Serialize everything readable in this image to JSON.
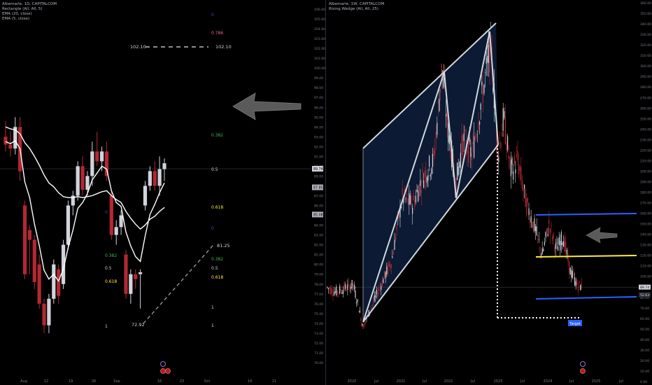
{
  "left_panel": {
    "legend": [
      "Albemarle, 1D, CAPITALCOM",
      "Rectangle (All, All, 5)",
      "EMA (20, close)",
      "EMA (5, close)"
    ],
    "price_axis": {
      "min": 69.0,
      "max": 106.0,
      "ticks": [
        70.0,
        71.0,
        72.0,
        73.0,
        74.0,
        75.0,
        76.0,
        77.0,
        78.0,
        79.0,
        80.0,
        81.0,
        82.0,
        83.0,
        84.0,
        85.0,
        86.0,
        87.0,
        88.0,
        89.0,
        90.0,
        91.0,
        92.0,
        93.0,
        94.0,
        95.0,
        96.0,
        97.0,
        98.0,
        99.0,
        100.0,
        101.0,
        102.0,
        103.0,
        104.0,
        105.0,
        106.0
      ]
    },
    "price_badges": [
      "89.74",
      "87.85",
      "85.08"
    ],
    "time_axis": [
      "Aug",
      "12",
      "19",
      "26",
      "Sep",
      "16",
      "23",
      "Oct",
      "14",
      "21"
    ],
    "levels": {
      "top_left": "102.10",
      "top_right": "102.10",
      "lower_right": "81.25",
      "bottom_left": "72.92"
    },
    "fib_right": [
      {
        "label": "0",
        "color": "#3f51b5"
      },
      {
        "label": "0.786",
        "color": "#f06292"
      },
      {
        "label": "0.382",
        "color": "#4caf50"
      },
      {
        "label": "0.5",
        "color": "#d1d4dc"
      },
      {
        "label": "0.618",
        "color": "#ffeb3b"
      },
      {
        "label": "0",
        "color": "#3f51b5"
      },
      {
        "label": "0.382",
        "color": "#4caf50"
      },
      {
        "label": "0.5",
        "color": "#d1d4dc"
      },
      {
        "label": "0.618",
        "color": "#ffeb3b"
      },
      {
        "label": "1",
        "color": "#d1d4dc"
      },
      {
        "label": "1",
        "color": "#d1d4dc"
      }
    ],
    "fib_mid": [
      {
        "label": "0",
        "color": "#3f51b5"
      },
      {
        "label": "0.382",
        "color": "#4caf50"
      },
      {
        "label": "0.5",
        "color": "#d1d4dc"
      },
      {
        "label": "0.618",
        "color": "#ffeb3b"
      },
      {
        "label": "1",
        "color": "#d1d4dc"
      }
    ]
  },
  "right_panel": {
    "legend": [
      "Albemarle, 1W, CAPITALCOM",
      "Rising Wedge (All, All, 25)"
    ],
    "price_axis": {
      "min": 0,
      "max": 360,
      "ticks": [
        0.0,
        10.0,
        20.0,
        30.0,
        40.0,
        50.0,
        60.0,
        70.0,
        80.0,
        90.0,
        100.0,
        110.0,
        120.0,
        130.0,
        140.0,
        150.0,
        160.0,
        170.0,
        180.0,
        190.0,
        200.0,
        210.0,
        220.0,
        230.0,
        240.0,
        250.0,
        260.0,
        270.0,
        280.0,
        290.0,
        300.0,
        310.0,
        320.0,
        330.0,
        340.0,
        350.0,
        360.0
      ]
    },
    "price_badges": [
      "89.74",
      "52.63"
    ],
    "time_axis": [
      "2020",
      "Jul",
      "2021",
      "Jul",
      "2022",
      "Jul",
      "2023",
      "Jul",
      "2024",
      "Jul",
      "2025",
      "Jul"
    ],
    "target_label": "Target"
  },
  "colors": {
    "up": "#d1d4dc",
    "down": "#b22833",
    "wedge_fill": "#0d1b36",
    "support_blue": "#2962ff",
    "support_yellow": "#ffeb3b"
  },
  "chart_data": [
    {
      "type": "candlestick",
      "title": "Albemarle, 1D, CAPITALCOM",
      "ylim": [
        69,
        106
      ],
      "x": [
        "Aug 1",
        "Aug 2",
        "Aug 5",
        "Aug 6",
        "Aug 7",
        "Aug 8",
        "Aug 9",
        "Aug 12",
        "Aug 13",
        "Aug 14",
        "Aug 15",
        "Aug 16",
        "Aug 19",
        "Aug 20",
        "Aug 21",
        "Aug 22",
        "Aug 23",
        "Aug 26",
        "Aug 27",
        "Aug 28",
        "Aug 29",
        "Aug 30",
        "Sep 3",
        "Sep 4",
        "Sep 5",
        "Sep 6",
        "Sep 9",
        "Sep 10",
        "Sep 11",
        "Sep 12",
        "Sep 13",
        "Sep 16",
        "Sep 17",
        "Sep 18"
      ],
      "ohlc": [
        [
          93.0,
          94.6,
          91.5,
          92.2
        ],
        [
          92.2,
          93.5,
          91.0,
          91.8
        ],
        [
          91.8,
          95.0,
          91.2,
          94.0
        ],
        [
          94.0,
          95.0,
          88.5,
          89.5
        ],
        [
          86.0,
          86.5,
          78.5,
          79.0
        ],
        [
          83.5,
          84.0,
          79.0,
          82.5
        ],
        [
          82.5,
          83.0,
          77.5,
          78.2
        ],
        [
          80.0,
          81.0,
          75.5,
          76.0
        ],
        [
          76.0,
          76.5,
          73.0,
          73.8
        ],
        [
          73.8,
          77.0,
          73.0,
          76.5
        ],
        [
          76.5,
          80.5,
          76.0,
          80.0
        ],
        [
          79.5,
          80.0,
          76.0,
          76.8
        ],
        [
          78.0,
          82.5,
          77.5,
          82.0
        ],
        [
          82.0,
          86.5,
          81.5,
          86.0
        ],
        [
          86.0,
          87.5,
          85.0,
          87.0
        ],
        [
          87.0,
          90.5,
          86.5,
          90.0
        ],
        [
          90.0,
          91.0,
          87.0,
          87.6
        ],
        [
          87.6,
          89.5,
          87.0,
          89.0
        ],
        [
          89.0,
          92.5,
          88.0,
          91.5
        ],
        [
          91.5,
          93.5,
          90.0,
          90.5
        ],
        [
          90.5,
          92.0,
          89.5,
          91.5
        ],
        [
          91.5,
          92.5,
          88.5,
          89.0
        ],
        [
          87.0,
          87.5,
          82.5,
          83.0
        ],
        [
          83.0,
          84.5,
          82.0,
          83.8
        ],
        [
          83.8,
          85.5,
          83.0,
          85.0
        ],
        [
          81.0,
          81.5,
          76.5,
          77.0
        ],
        [
          77.0,
          79.5,
          76.0,
          79.0
        ],
        [
          79.0,
          79.5,
          77.5,
          78.5
        ],
        [
          79.0,
          79.5,
          75.5,
          79.2
        ],
        [
          86.0,
          88.5,
          85.5,
          88.0
        ],
        [
          88.0,
          90.0,
          87.5,
          89.5
        ],
        [
          89.5,
          90.5,
          87.5,
          88.0
        ],
        [
          88.0,
          91.0,
          87.0,
          89.7
        ],
        [
          89.7,
          90.8,
          88.5,
          90.3
        ]
      ],
      "ema5": [
        92.5,
        92.3,
        92.6,
        91.8,
        88.4,
        86.8,
        84.1,
        81.9,
        79.4,
        78.5,
        79.0,
        78.3,
        79.5,
        81.7,
        83.5,
        85.7,
        86.3,
        87.2,
        88.6,
        89.3,
        90.0,
        89.7,
        87.5,
        86.3,
        85.9,
        83.3,
        81.9,
        80.8,
        80.3,
        82.9,
        85.1,
        86.1,
        87.3,
        88.3
      ],
      "ema20": [
        94.0,
        93.8,
        93.7,
        93.3,
        92.4,
        91.8,
        91.0,
        90.1,
        89.1,
        88.3,
        87.9,
        87.3,
        86.9,
        86.8,
        86.8,
        86.9,
        86.8,
        86.9,
        87.0,
        87.2,
        87.4,
        87.5,
        87.0,
        86.6,
        86.3,
        85.4,
        84.7,
        84.1,
        83.6,
        84.0,
        84.6,
        84.9,
        85.4,
        85.8
      ]
    },
    {
      "type": "candlestick",
      "title": "Albemarle, 1W, CAPITALCOM",
      "ylim": [
        0,
        360
      ],
      "x_range": [
        "2019-09",
        "2025-10"
      ],
      "last_price": 89.74,
      "target_price": 52.63
    }
  ]
}
